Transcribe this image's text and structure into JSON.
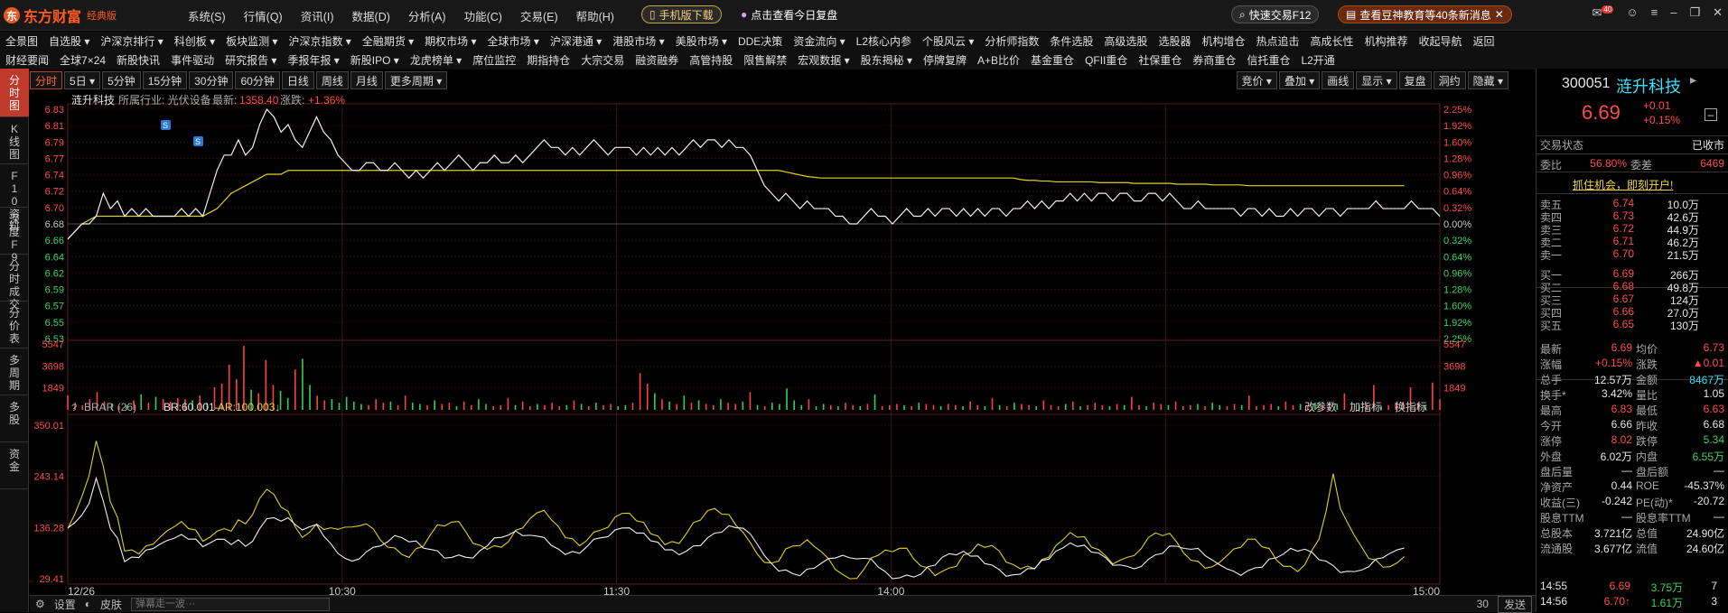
{
  "app": {
    "name": "东方财富",
    "edition": "经典版"
  },
  "menus": [
    "系统(S)",
    "行情(Q)",
    "资讯(I)",
    "数据(D)",
    "分析(A)",
    "功能(C)",
    "交易(E)",
    "帮助(H)"
  ],
  "pills": {
    "mobile": "手机版下载",
    "review": "点击查看今日复盘",
    "quick": "快速交易F12",
    "news": "查看豆神教育等40条新消息",
    "badge": "40"
  },
  "nav1": [
    "全景图",
    "自选股 ▾",
    "沪深京排行 ▾",
    "科创板 ▾",
    "板块监测 ▾",
    "沪深京指数 ▾",
    "全融期货 ▾",
    "期权市场 ▾",
    "全球市场 ▾",
    "沪深港通 ▾",
    "港股市场 ▾",
    "美股市场 ▾",
    "DDE决策",
    "资金流向 ▾",
    "L2核心内参",
    "个股风云 ▾",
    "分析师指数",
    "条件选股",
    "高级选股",
    "选股器",
    "机构增仓",
    "热点追击",
    "高成长性",
    "机构推荐",
    "收起导航",
    "返回"
  ],
  "nav2": [
    "财经要闻",
    "全球7×24",
    "新股快讯",
    "事件驱动",
    "研究报告 ▾",
    "季报年报 ▾",
    "新股IPO ▾",
    "龙虎榜单 ▾",
    "席位监控",
    "期指持仓",
    "大宗交易",
    "融资融券",
    "高管持股",
    "限售解禁",
    "宏观数据 ▾",
    "股东揭秘 ▾",
    "停牌复牌",
    "A+B比价",
    "基金重仓",
    "QFII重仓",
    "社保重仓",
    "券商重仓",
    "信托重仓",
    "L2开通"
  ],
  "leftbar": [
    {
      "label": "分时图",
      "active": true
    },
    {
      "label": "K线图"
    },
    {
      "label": "F10资料"
    },
    {
      "label": "深度F9"
    },
    {
      "label": "分时成交"
    },
    {
      "label": "分价表"
    },
    {
      "label": "多周期"
    },
    {
      "label": "多股"
    },
    {
      "label": "资金"
    }
  ],
  "periods": [
    "分时",
    "5日 ▾",
    "5分钟",
    "15分钟",
    "30分钟",
    "60分钟",
    "日线",
    "周线",
    "月线",
    "更多周期 ▾"
  ],
  "tools": [
    "竞价 ▾",
    "叠加 ▾",
    "画线",
    "显示 ▾",
    "复盘",
    "洞约",
    "隐藏 ▾"
  ],
  "info": {
    "stock": "涟升科技",
    "industry": "所属行业: 光伏设备",
    "latest_label": "最新:",
    "latest": "1358.40",
    "chg_label": "涨跌:",
    "chg": "+1.36%"
  },
  "indicator": {
    "name": "BRAR (26)",
    "br": "BR:60.001–",
    "ar": "AR:100.003↓",
    "buttons": [
      "改参数",
      "加指标",
      "换指标"
    ]
  },
  "bottom": {
    "settings": "设置",
    "skin": "皮肤",
    "danmu": "弹幕走一波···",
    "count": "30",
    "send": "发送"
  },
  "quote": {
    "code": "300051",
    "name": "涟升科技",
    "price": "6.69",
    "change": "+0.01",
    "pct": "+0.15%",
    "status_label": "交易状态",
    "status": "已收市",
    "wb_label": "委比",
    "wb": "56.80%",
    "wc_label": "委差",
    "wc": "6469",
    "promo": "抓住机会，即刻开户!",
    "asks": [
      [
        "卖五",
        "6.74",
        "10.0万"
      ],
      [
        "卖四",
        "6.73",
        "42.6万"
      ],
      [
        "卖三",
        "6.72",
        "44.9万"
      ],
      [
        "卖二",
        "6.71",
        "46.2万"
      ],
      [
        "卖一",
        "6.70",
        "21.5万"
      ]
    ],
    "bids": [
      [
        "买一",
        "6.69",
        "266万"
      ],
      [
        "买二",
        "6.68",
        "49.8万"
      ],
      [
        "买三",
        "6.67",
        "124万"
      ],
      [
        "买四",
        "6.66",
        "27.0万"
      ],
      [
        "买五",
        "6.65",
        "130万"
      ]
    ],
    "stats": [
      [
        "最新",
        "6.69",
        "均价",
        "6.73"
      ],
      [
        "涨幅",
        "+0.15%",
        "涨跌",
        "▲0.01"
      ],
      [
        "总手",
        "12.57万",
        "金额",
        "8467万"
      ],
      [
        "换手*",
        "3.42%",
        "量比",
        "1.05"
      ],
      [
        "最高",
        "6.83",
        "最低",
        "6.63"
      ],
      [
        "今开",
        "6.66",
        "昨收",
        "6.68"
      ],
      [
        "涨停",
        "8.02",
        "跌停",
        "5.34"
      ],
      [
        "外盘",
        "6.02万",
        "内盘",
        "6.55万"
      ],
      [
        "盘后量",
        "—",
        "盘后额",
        "—"
      ],
      [
        "净资产",
        "0.44",
        "ROE",
        "-45.37%"
      ],
      [
        "收益(三)",
        "-0.242",
        "PE(动)*",
        "-20.72"
      ],
      [
        "股息TTM",
        "—",
        "股息率TTM",
        "—"
      ],
      [
        "总股本",
        "3.721亿",
        "总值",
        "24.90亿"
      ],
      [
        "流通股",
        "3.677亿",
        "流值",
        "24.60亿"
      ]
    ],
    "ticks": [
      [
        "14:55",
        "6.69",
        "3.75万",
        "7"
      ],
      [
        "14:56",
        "6.70↑",
        "1.61万",
        "3"
      ]
    ]
  },
  "chart_data": {
    "type": "line",
    "price_axis": [
      "6.83",
      "6.81",
      "6.79",
      "6.77",
      "6.74",
      "6.72",
      "6.70",
      "6.68",
      "6.66",
      "6.64",
      "6.62",
      "6.59",
      "6.57",
      "6.55",
      "6.53"
    ],
    "pct_axis": [
      "2.25%",
      "1.92%",
      "1.60%",
      "1.28%",
      "0.96%",
      "0.64%",
      "0.32%",
      "0.00%",
      "0.32%",
      "0.64%",
      "0.96%",
      "1.28%",
      "1.60%",
      "1.92%",
      "2.25%"
    ],
    "vol_axis": [
      "5547",
      "3698",
      "1849"
    ],
    "ind_axis": [
      "350.01",
      "243.14",
      "136.28",
      "29.41"
    ],
    "time_labels": [
      "12/26",
      "10:30",
      "11:30",
      "14:00",
      "15:00"
    ],
    "ylim": [
      6.53,
      6.83
    ],
    "price": [
      6.66,
      6.67,
      6.68,
      6.68,
      6.69,
      6.72,
      6.7,
      6.71,
      6.69,
      6.7,
      6.69,
      6.7,
      6.69,
      6.69,
      6.69,
      6.69,
      6.7,
      6.69,
      6.7,
      6.69,
      6.72,
      6.75,
      6.77,
      6.77,
      6.79,
      6.77,
      6.78,
      6.81,
      6.83,
      6.82,
      6.8,
      6.81,
      6.79,
      6.78,
      6.8,
      6.82,
      6.8,
      6.79,
      6.77,
      6.76,
      6.75,
      6.75,
      6.76,
      6.76,
      6.75,
      6.75,
      6.76,
      6.75,
      6.74,
      6.75,
      6.74,
      6.75,
      6.76,
      6.75,
      6.76,
      6.77,
      6.76,
      6.75,
      6.76,
      6.76,
      6.77,
      6.76,
      6.76,
      6.77,
      6.76,
      6.77,
      6.78,
      6.79,
      6.78,
      6.78,
      6.77,
      6.78,
      6.77,
      6.78,
      6.79,
      6.78,
      6.77,
      6.78,
      6.78,
      6.78,
      6.77,
      6.78,
      6.77,
      6.78,
      6.77,
      6.78,
      6.77,
      6.78,
      6.79,
      6.78,
      6.79,
      6.79,
      6.78,
      6.79,
      6.78,
      6.78,
      6.77,
      6.75,
      6.73,
      6.72,
      6.71,
      6.72,
      6.71,
      6.7,
      6.71,
      6.7,
      6.7,
      6.7,
      6.69,
      6.69,
      6.68,
      6.68,
      6.69,
      6.7,
      6.69,
      6.69,
      6.68,
      6.69,
      6.7,
      6.69,
      6.69,
      6.7,
      6.69,
      6.7,
      6.7,
      6.69,
      6.7,
      6.69,
      6.7,
      6.69,
      6.7,
      6.7,
      6.69,
      6.7,
      6.7,
      6.71,
      6.7,
      6.71,
      6.7,
      6.71,
      6.71,
      6.72,
      6.71,
      6.72,
      6.71,
      6.72,
      6.72,
      6.71,
      6.72,
      6.72,
      6.71,
      6.71,
      6.72,
      6.72,
      6.71,
      6.72,
      6.71,
      6.7,
      6.7,
      6.71,
      6.7,
      6.7,
      6.7,
      6.7,
      6.7,
      6.69,
      6.7,
      6.7,
      6.69,
      6.7,
      6.69,
      6.69,
      6.7,
      6.69,
      6.7,
      6.7,
      6.69,
      6.7,
      6.7,
      6.69,
      6.7,
      6.7,
      6.7,
      6.7,
      6.71,
      6.7,
      6.7,
      6.7,
      6.7,
      6.71,
      6.7,
      6.7,
      6.7,
      6.69
    ],
    "avg": [
      6.66,
      6.67,
      6.68,
      6.685,
      6.69,
      6.69,
      6.69,
      6.69,
      6.69,
      6.69,
      6.69,
      6.69,
      6.69,
      6.69,
      6.69,
      6.69,
      6.69,
      6.69,
      6.69,
      6.69,
      6.695,
      6.7,
      6.71,
      6.72,
      6.725,
      6.73,
      6.735,
      6.74,
      6.745,
      6.745,
      6.745,
      6.75,
      6.75,
      6.75,
      6.75,
      6.75,
      6.75,
      6.75,
      6.75,
      6.75,
      6.75,
      6.75,
      6.75,
      6.75,
      6.75,
      6.75,
      6.75,
      6.75,
      6.75,
      6.75,
      6.75,
      6.75,
      6.75,
      6.75,
      6.75,
      6.75,
      6.75,
      6.75,
      6.75,
      6.75,
      6.75,
      6.75,
      6.75,
      6.75,
      6.75,
      6.75,
      6.75,
      6.75,
      6.75,
      6.75,
      6.75,
      6.75,
      6.75,
      6.75,
      6.75,
      6.75,
      6.75,
      6.75,
      6.75,
      6.75,
      6.75,
      6.75,
      6.75,
      6.75,
      6.75,
      6.75,
      6.75,
      6.75,
      6.75,
      6.75,
      6.75,
      6.75,
      6.75,
      6.75,
      6.75,
      6.75,
      6.75,
      6.75,
      6.75,
      6.75,
      6.75,
      6.748,
      6.746,
      6.744,
      6.742,
      6.741,
      6.74,
      6.74,
      6.74,
      6.74,
      6.74,
      6.74,
      6.74,
      6.74,
      6.74,
      6.74,
      6.74,
      6.74,
      6.74,
      6.74,
      6.74,
      6.74,
      6.74,
      6.74,
      6.74,
      6.74,
      6.74,
      6.74,
      6.74,
      6.74,
      6.74,
      6.74,
      6.74,
      6.74,
      6.738,
      6.737,
      6.737,
      6.736,
      6.736,
      6.735,
      6.735,
      6.735,
      6.735,
      6.735,
      6.735,
      6.734,
      6.734,
      6.734,
      6.734,
      6.734,
      6.733,
      6.733,
      6.733,
      6.733,
      6.733,
      6.733,
      6.732,
      6.732,
      6.732,
      6.732,
      6.732,
      6.731,
      6.731,
      6.731,
      6.731,
      6.731,
      6.73,
      6.73,
      6.73,
      6.73,
      6.73,
      6.73,
      6.73,
      6.73,
      6.73,
      6.73,
      6.73,
      6.73,
      6.73,
      6.73,
      6.73,
      6.73,
      6.73,
      6.73,
      6.73,
      6.73,
      6.73,
      6.73,
      6.73
    ],
    "volume": [
      1200,
      600,
      400,
      900,
      1500,
      700,
      500,
      300,
      400,
      800,
      1300,
      600,
      1100,
      900,
      700,
      1000,
      900,
      800,
      1200,
      600,
      1900,
      2200,
      3800,
      2600,
      5400,
      1700,
      1400,
      4200,
      2100,
      1600,
      1000,
      3400,
      4300,
      2100,
      1200,
      800,
      900,
      600,
      1100,
      700,
      500,
      400,
      900,
      600,
      700,
      400,
      1200,
      600,
      500,
      400,
      800,
      500,
      600,
      300,
      700,
      400,
      900,
      500,
      300,
      400,
      1000,
      400,
      700,
      300,
      500,
      400,
      600,
      300,
      400,
      800,
      500,
      300,
      600,
      400,
      500,
      300,
      400,
      600,
      3100,
      2200,
      1400,
      900,
      700,
      500,
      1200,
      600,
      800,
      500,
      400,
      900,
      600,
      500,
      700,
      1500,
      400,
      300,
      600,
      500,
      1800,
      800,
      400,
      900,
      300,
      500,
      400,
      300,
      600,
      400,
      300,
      500,
      1300,
      300,
      400,
      500,
      400,
      300,
      600,
      500,
      400,
      300,
      500,
      400,
      300,
      700,
      400,
      300,
      1000,
      400,
      300,
      600,
      500,
      400,
      300,
      800,
      400,
      300,
      500,
      700,
      300,
      400,
      600,
      400,
      300,
      500,
      400,
      1100,
      400,
      300,
      600,
      500,
      400,
      700,
      300,
      400,
      500,
      300,
      600,
      400,
      300,
      500,
      400,
      1200,
      300,
      400,
      500,
      300,
      700,
      400,
      500,
      300,
      600,
      400,
      300,
      500,
      1400,
      300,
      400,
      500,
      2100,
      300,
      400,
      600,
      700,
      1900,
      600,
      400,
      2300,
      900
    ]
  }
}
